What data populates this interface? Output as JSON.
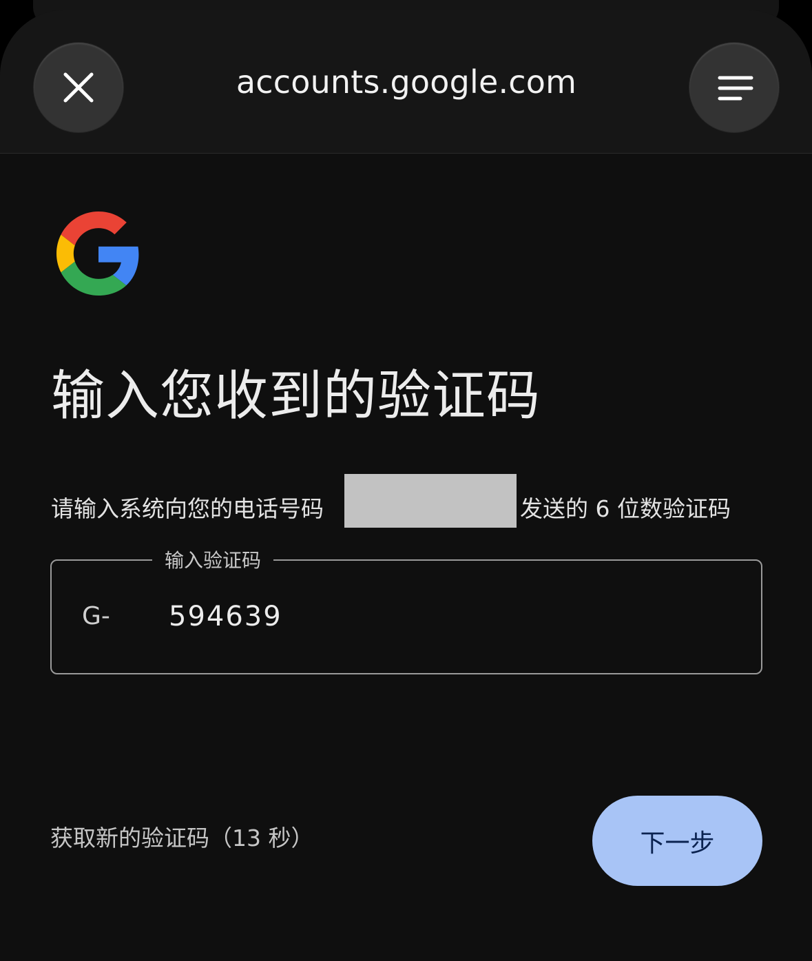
{
  "browser": {
    "url": "accounts.google.com",
    "close_icon": "close-icon",
    "menu_icon": "menu-icon"
  },
  "page": {
    "logo": "google-g-logo",
    "title": "输入您收到的验证码",
    "description_before": "请输入系统向您的电话号码 ",
    "description_after": "发送的 6 位数验证码"
  },
  "code_field": {
    "label": "输入验证码",
    "prefix": "G-",
    "value": "594639"
  },
  "footer": {
    "resend_text": "获取新的验证码（13 秒）",
    "next_label": "下一步"
  },
  "colors": {
    "background": "#0f0f0f",
    "toolbar": "#161616",
    "button_primary": "#a8c4f6",
    "button_text": "#0b2350"
  }
}
